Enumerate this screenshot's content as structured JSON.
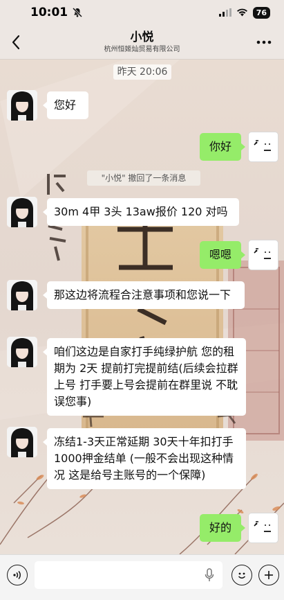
{
  "status_bar": {
    "time": "10:01",
    "battery": "76"
  },
  "header": {
    "title": "小悦",
    "subtitle": "杭州恒姬灿贸易有限公司"
  },
  "chat": {
    "timestamp": "昨天 20:06",
    "recall_notice": "\"小悦\" 撤回了一条消息",
    "messages": [
      {
        "from": "contact",
        "text": "您好"
      },
      {
        "from": "me",
        "text": "你好"
      },
      {
        "from": "contact",
        "text": "30m 4甲 3头 13aw报价 120 对吗"
      },
      {
        "from": "me",
        "text": "嗯嗯"
      },
      {
        "from": "contact",
        "text": "那这边将流程合注意事项和您说一下"
      },
      {
        "from": "contact",
        "text": "咱们这边是自家打手纯绿护航  您的租期为  2天   提前打完提前结(后续会拉群上号  打手要上号会提前在群里说  不耽误您事)"
      },
      {
        "from": "contact",
        "text": "冻结1-3天正常延期  30天十年扣打手1000押金结单 (一般不会出现这种情况  这是给号主账号的一个保障)"
      },
      {
        "from": "me",
        "text": "好的"
      }
    ]
  },
  "icons": {
    "back": "chevron-left-icon",
    "more": "more-dots-icon",
    "voice": "voice-icon",
    "mic": "mic-icon",
    "emoji": "emoji-icon",
    "plus": "plus-icon",
    "mute": "bell-slash-icon",
    "signal": "signal-icon",
    "wifi": "wifi-icon"
  },
  "colors": {
    "outgoing_bubble": "#95ec69",
    "incoming_bubble": "#ffffff"
  }
}
